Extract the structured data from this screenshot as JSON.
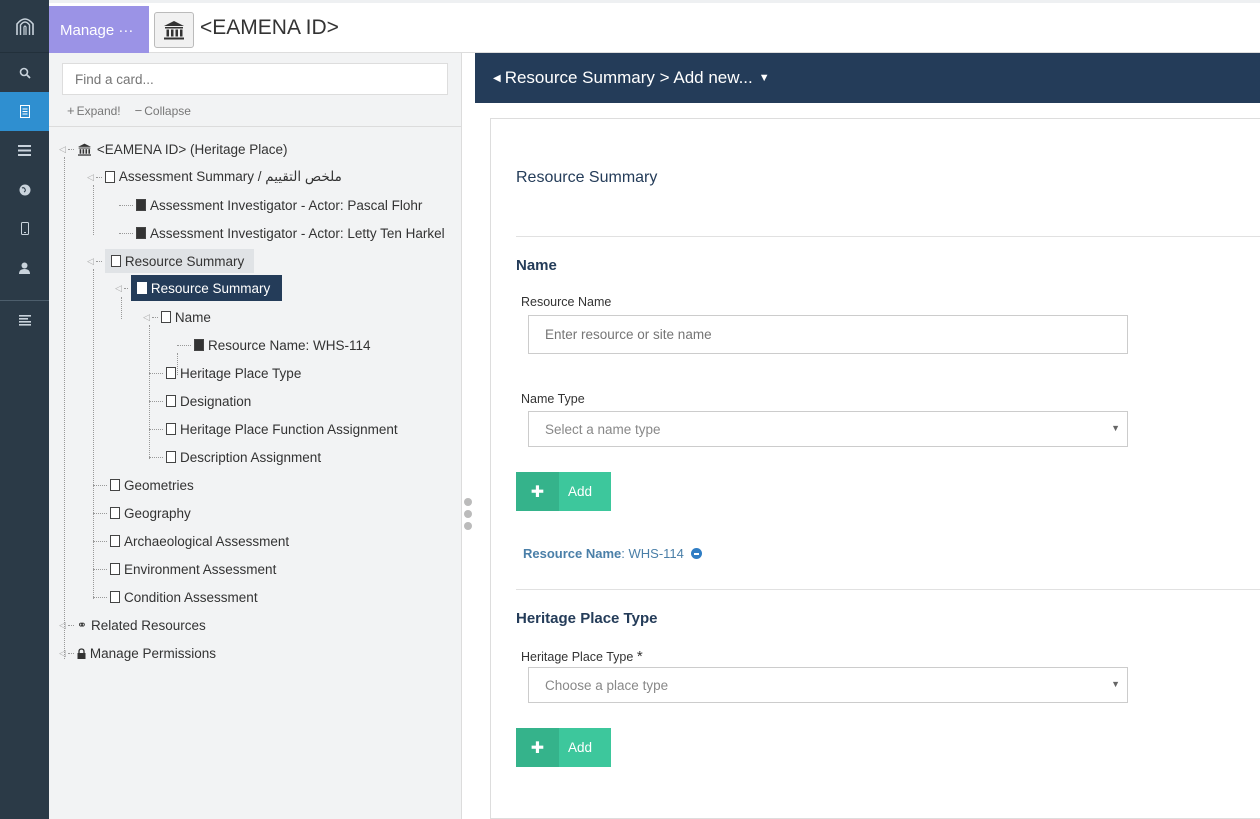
{
  "topbar": {
    "manage_label": "Manage ···",
    "resource_title": "<EAMENA ID>"
  },
  "rail": {
    "icons": [
      "arches-logo-icon",
      "search-icon",
      "resource-editor-icon",
      "layers-icon",
      "globe-icon",
      "mobile-icon",
      "user-icon",
      "menu-lines-icon"
    ]
  },
  "tree": {
    "search_placeholder": "Find a card...",
    "expand_label": "Expand!",
    "collapse_label": "Collapse",
    "nodes": [
      "<EAMENA ID> (Heritage Place)",
      "Assessment Summary / ملخص التقييم",
      "Assessment Investigator - Actor: Pascal Flohr",
      "Assessment Investigator - Actor: Letty Ten Harkel",
      "Resource Summary",
      "Resource Summary",
      "Name",
      "Resource Name: WHS-114",
      "Heritage Place Type",
      "Designation",
      "Heritage Place Function Assignment",
      "Description Assignment",
      "Geometries",
      "Geography",
      "Archaeological Assessment",
      "Environment Assessment",
      "Condition Assessment",
      "Related Resources",
      "Manage Permissions"
    ]
  },
  "card": {
    "header": "Resource Summary > Add new...",
    "title": "Resource Summary",
    "name_section": "Name",
    "resource_name_label": "Resource Name",
    "resource_name_placeholder": "Enter resource or site name",
    "name_type_label": "Name Type",
    "name_type_placeholder": "Select a name type",
    "add_label": "Add",
    "value_key": "Resource Name",
    "value_text": ": WHS-114",
    "hpt_section": "Heritage Place Type",
    "hpt_label": "Heritage Place Type",
    "required_mark": "*",
    "hpt_placeholder": "Choose a place type",
    "add_label_2": "Add"
  },
  "colors": {
    "rail_bg": "#2b3a47",
    "rail_active": "#2f8fd0",
    "manage_bg": "#9b93e6",
    "header_bg": "#243c59",
    "add_button": "#3dc79c"
  }
}
